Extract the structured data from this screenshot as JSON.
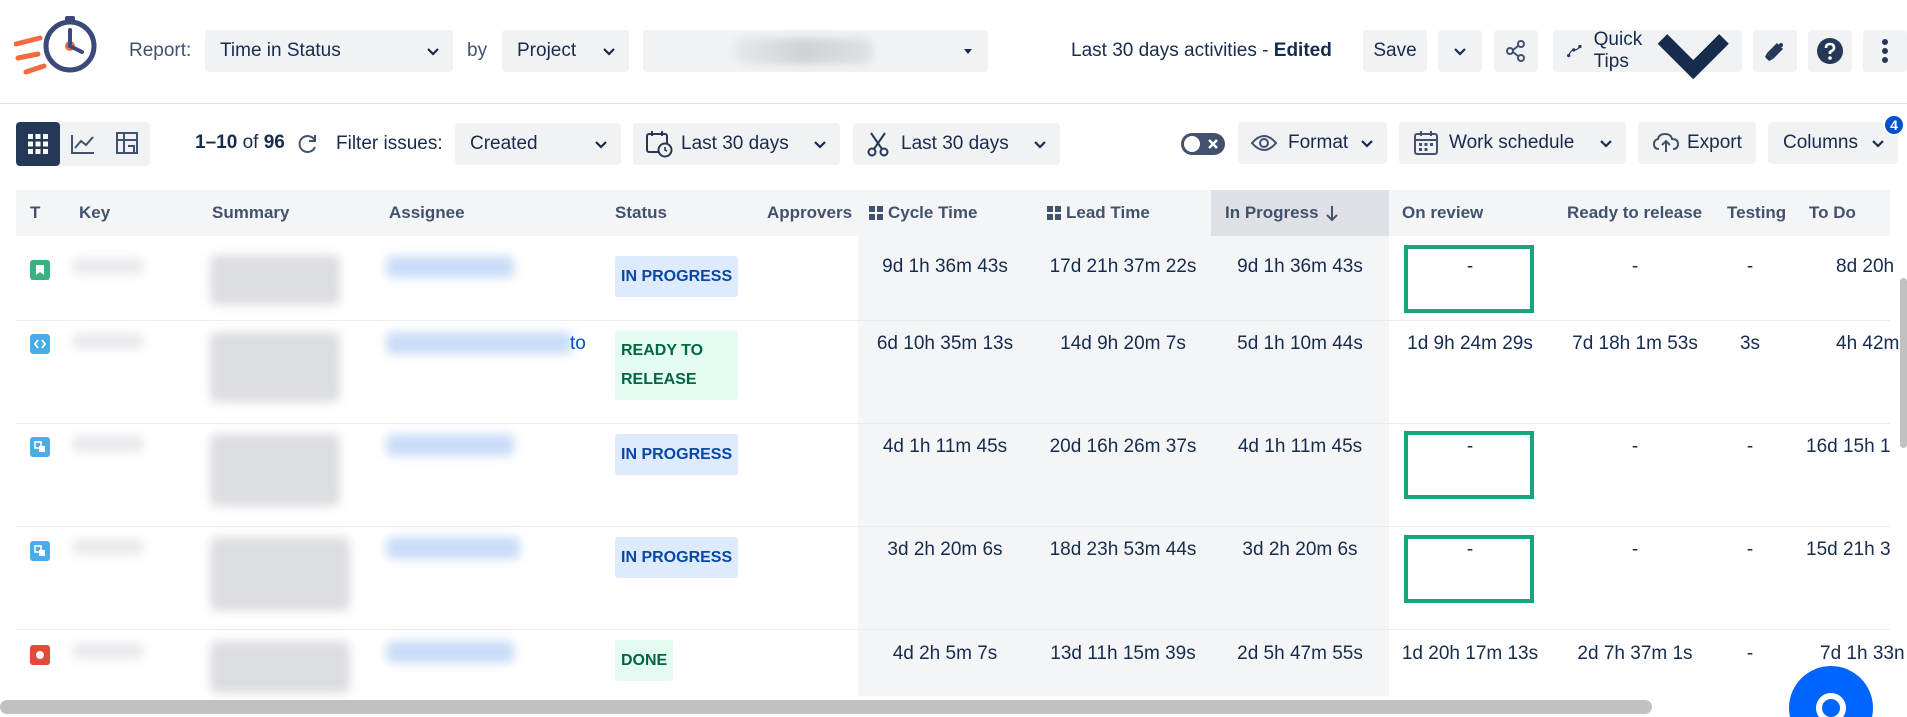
{
  "toolbar": {
    "report_label": "Report:",
    "report_value": "Time in Status",
    "by_label": "by",
    "group_value": "Project",
    "project_value": "",
    "activity_label": "Last 30 days activities",
    "activity_sep": " - ",
    "activity_state": "Edited",
    "save_label": "Save",
    "quick_tips_label": "Quick Tips"
  },
  "filterbar": {
    "range_start": "1",
    "range_sep": "–",
    "range_end": "10",
    "of_label": "of",
    "total": "96",
    "filter_label": "Filter issues:",
    "filter_value": "Created",
    "date_range_1": "Last 30 days",
    "date_range_2": "Last 30 days",
    "format_label": "Format",
    "work_schedule_label": "Work schedule",
    "export_label": "Export",
    "columns_label": "Columns",
    "columns_badge": "4"
  },
  "table": {
    "headers": {
      "t": "T",
      "key": "Key",
      "summary": "Summary",
      "assignee": "Assignee",
      "status": "Status",
      "approvers": "Approvers",
      "cycle_time": "Cycle Time",
      "lead_time": "Lead Time",
      "in_progress": "In Progress",
      "on_review": "On review",
      "ready_to_release": "Ready to release",
      "testing": "Testing",
      "to_do": "To Do"
    },
    "rows": [
      {
        "type_color": "#36b37e",
        "status": "IN PROGRESS",
        "assignee_suffix": "",
        "cycle_time": "9d 1h 36m 43s",
        "lead_time": "17d 21h 37m 22s",
        "in_progress": "9d 1h 36m 43s",
        "on_review": "-",
        "ready_to_release": "-",
        "testing": "-",
        "to_do": "8d 20h"
      },
      {
        "type_color": "#4bade8",
        "status_line1": "READY TO",
        "status_line2": "RELEASE",
        "assignee_suffix": "to",
        "cycle_time": "6d 10h 35m 13s",
        "lead_time": "14d 9h 20m 7s",
        "in_progress": "5d 1h 10m 44s",
        "on_review": "1d 9h 24m 29s",
        "ready_to_release": "7d 18h 1m 53s",
        "testing": "3s",
        "to_do": "4h 42m"
      },
      {
        "type_color": "#4bade8",
        "status": "IN PROGRESS",
        "assignee_suffix": "",
        "cycle_time": "4d 1h 11m 45s",
        "lead_time": "20d 16h 26m 37s",
        "in_progress": "4d 1h 11m 45s",
        "on_review": "-",
        "ready_to_release": "-",
        "testing": "-",
        "to_do": "16d 15h 1"
      },
      {
        "type_color": "#4bade8",
        "status": "IN PROGRESS",
        "assignee_suffix": "",
        "cycle_time": "3d 2h 20m 6s",
        "lead_time": "18d 23h 53m 44s",
        "in_progress": "3d 2h 20m 6s",
        "on_review": "-",
        "ready_to_release": "-",
        "testing": "-",
        "to_do": "15d 21h 3"
      },
      {
        "type_color": "#e5493a",
        "status": "DONE",
        "assignee_suffix": "",
        "cycle_time": "4d 2h 5m 7s",
        "lead_time": "13d 11h 15m 39s",
        "in_progress": "2d 5h 47m 55s",
        "on_review": "1d 20h 17m 13s",
        "ready_to_release": "2d 7h 37m 1s",
        "testing": "-",
        "to_do": "7d 1h 33n"
      }
    ]
  },
  "colors": {
    "accent": "#0052cc",
    "highlight_border": "#1ba37e",
    "lozenge_in_progress_bg": "#deebff",
    "lozenge_in_progress_fg": "#0747a6",
    "lozenge_done_bg": "#e3fcef",
    "lozenge_done_fg": "#006644"
  }
}
